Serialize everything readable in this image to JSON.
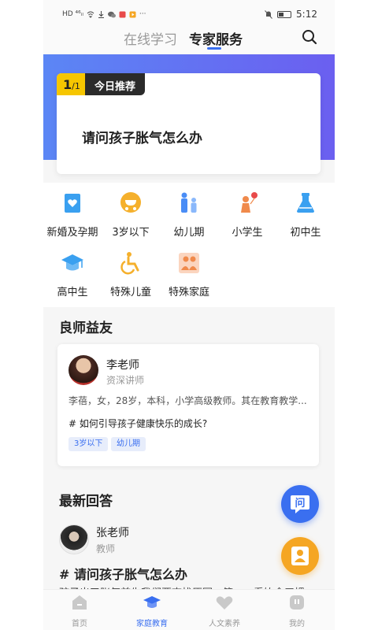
{
  "status_bar": {
    "time": "5:12",
    "left_text": "HD ⁴⁶ᵢₗ"
  },
  "top_tabs": {
    "online": "在线学习",
    "expert": "专家服务"
  },
  "recommendation": {
    "page_current": "1",
    "page_total": "/1",
    "tag": "今日推荐",
    "question": "请问孩子胀气怎么办"
  },
  "categories": [
    {
      "label": "新婚及孕期",
      "icon": "book-heart-icon",
      "color": "#3aa0f0"
    },
    {
      "label": "3岁以下",
      "icon": "stroller-icon",
      "color": "#f5b02c"
    },
    {
      "label": "幼儿期",
      "icon": "family-icon",
      "color": "#4a8df6"
    },
    {
      "label": "小学生",
      "icon": "child-balloon-icon",
      "color": "#f08a4b"
    },
    {
      "label": "初中生",
      "icon": "flask-icon",
      "color": "#3aa0f0"
    },
    {
      "label": "高中生",
      "icon": "graduation-cap-icon",
      "color": "#3aa0f0"
    },
    {
      "label": "特殊儿童",
      "icon": "wheelchair-icon",
      "color": "#f5b02c"
    },
    {
      "label": "特殊家庭",
      "icon": "family-frame-icon",
      "color": "#f08a4b"
    }
  ],
  "sections": {
    "teachers": "良师益友",
    "answers": "最新回答"
  },
  "teacher": {
    "name": "李老师",
    "role": "资深讲师",
    "bio": "李蓓，女，28岁，本科，小学高级教师。其在教育教学...",
    "question": "# 如何引导孩子健康快乐的成长?",
    "tags": [
      "3岁以下",
      "幼儿期"
    ]
  },
  "answer": {
    "name": "张老师",
    "role": "教师",
    "question": "# 请问孩子胀气怎么办",
    "snippet": "孩子出了胀气首先我们要查找原因，第一，看饮食习惯"
  },
  "fab": {
    "ask_label": "问"
  },
  "bottom_nav": [
    {
      "label": "首页",
      "icon": "home-icon"
    },
    {
      "label": "家庭教育",
      "icon": "graduation-cap-icon"
    },
    {
      "label": "人文素养",
      "icon": "heart-icon"
    },
    {
      "label": "我的",
      "icon": "profile-icon"
    }
  ],
  "colors": {
    "accent": "#3a6ff0",
    "hero_gradient_start": "#5b86f5",
    "hero_gradient_end": "#6b5ff0",
    "badge": "#f6c600"
  }
}
